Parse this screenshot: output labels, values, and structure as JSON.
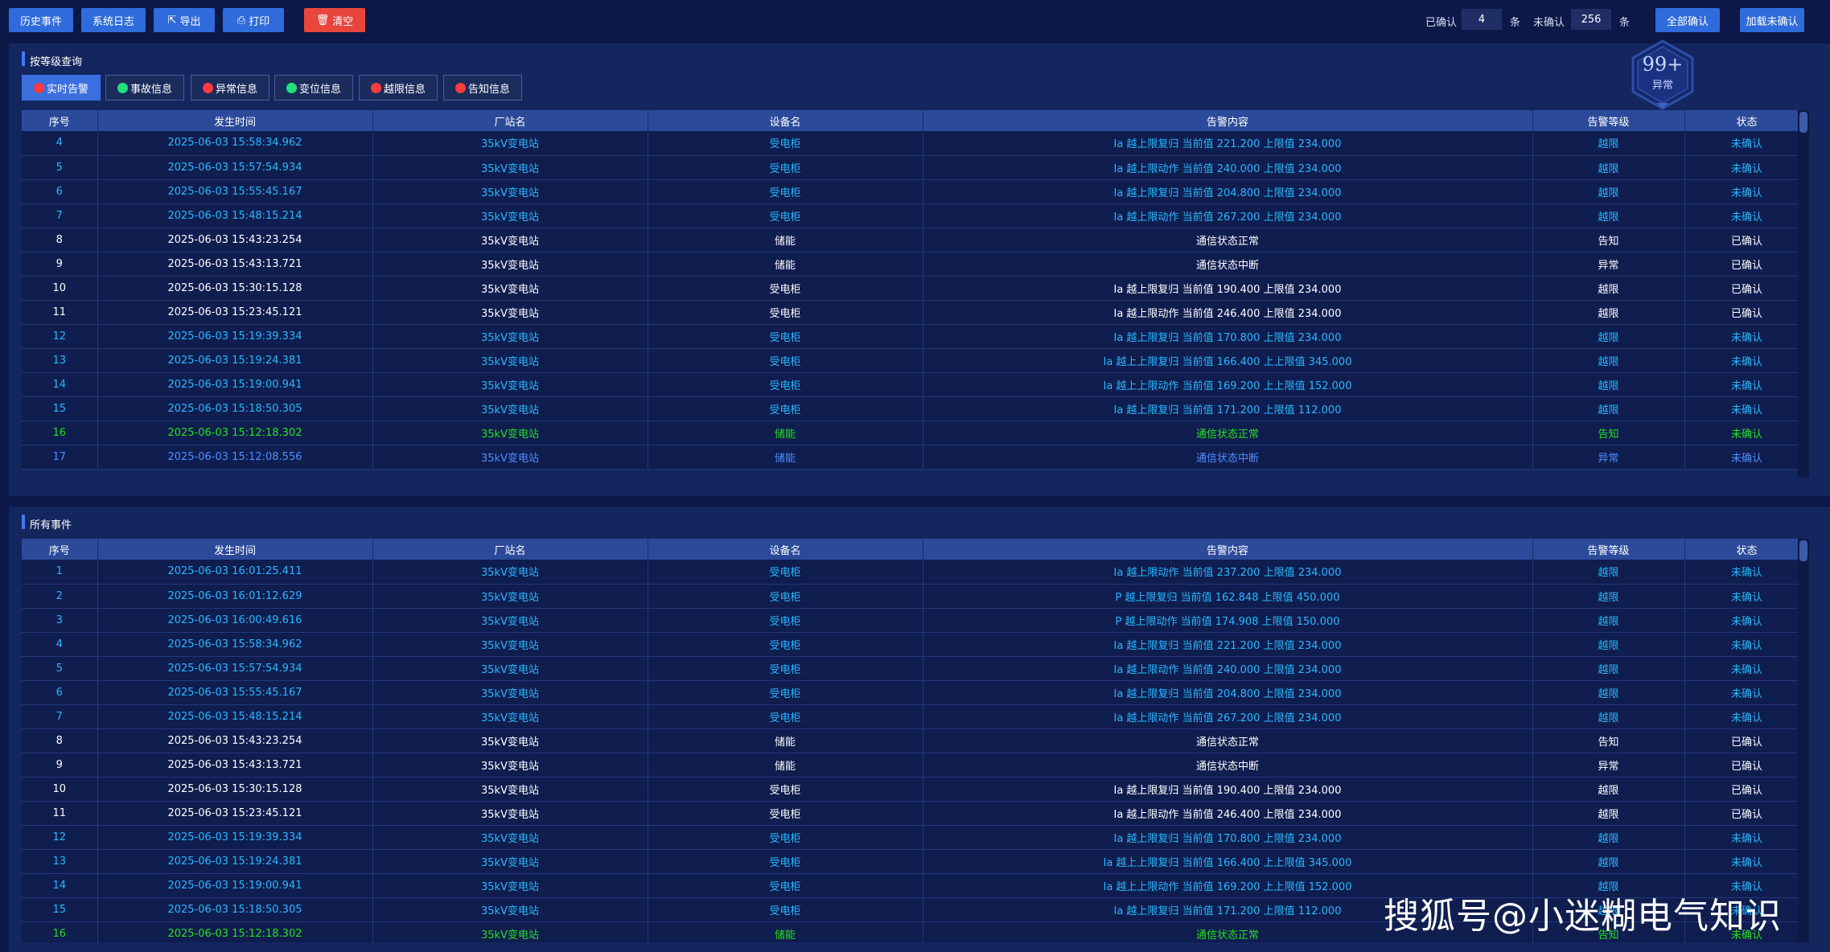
{
  "toolbar": {
    "history_label": "历史事件",
    "syslog_label": "系统日志",
    "export_label": "导出",
    "print_label": "打印",
    "clear_label": "清空",
    "confirmed_label": "已确认",
    "confirmed_count": "4",
    "unit1": "条",
    "unconfirmed_label": "未确认",
    "unconfirmed_count": "256",
    "unit2": "条",
    "confirm_all_label": "全部确认",
    "load_unconfirmed_label": "加载未确认"
  },
  "badge": {
    "count": "99+",
    "label": "异常"
  },
  "panel1": {
    "title": "按等级查询",
    "tabs": [
      {
        "label": "实时告警",
        "dot": "red"
      },
      {
        "label": "事故信息",
        "dot": "green"
      },
      {
        "label": "异常信息",
        "dot": "red"
      },
      {
        "label": "变位信息",
        "dot": "green"
      },
      {
        "label": "越限信息",
        "dot": "red"
      },
      {
        "label": "告知信息",
        "dot": "red"
      }
    ]
  },
  "panel2": {
    "title": "所有事件"
  },
  "columns": [
    "序号",
    "发生时间",
    "厂站名",
    "设备名",
    "告警内容",
    "告警等级",
    "状态"
  ],
  "table1_rows": [
    {
      "c": "cyan",
      "v": [
        "4",
        "2025-06-03 15:58:34.962",
        "35kV变电站",
        "受电柜",
        "Ia 越上限复归 当前值 221.200 上限值 234.000",
        "越限",
        "未确认"
      ]
    },
    {
      "c": "cyan",
      "v": [
        "5",
        "2025-06-03 15:57:54.934",
        "35kV变电站",
        "受电柜",
        "Ia 越上限动作 当前值 240.000 上限值 234.000",
        "越限",
        "未确认"
      ]
    },
    {
      "c": "cyan",
      "v": [
        "6",
        "2025-06-03 15:55:45.167",
        "35kV变电站",
        "受电柜",
        "Ia 越上限复归 当前值 204.800 上限值 234.000",
        "越限",
        "未确认"
      ]
    },
    {
      "c": "cyan",
      "v": [
        "7",
        "2025-06-03 15:48:15.214",
        "35kV变电站",
        "受电柜",
        "Ia 越上限动作 当前值 267.200 上限值 234.000",
        "越限",
        "未确认"
      ]
    },
    {
      "c": "white",
      "v": [
        "8",
        "2025-06-03 15:43:23.254",
        "35kV变电站",
        "储能",
        "通信状态正常",
        "告知",
        "已确认"
      ]
    },
    {
      "c": "white",
      "v": [
        "9",
        "2025-06-03 15:43:13.721",
        "35kV变电站",
        "储能",
        "通信状态中断",
        "异常",
        "已确认"
      ]
    },
    {
      "c": "white",
      "v": [
        "10",
        "2025-06-03 15:30:15.128",
        "35kV变电站",
        "受电柜",
        "Ia 越上限复归 当前值 190.400 上限值 234.000",
        "越限",
        "已确认"
      ]
    },
    {
      "c": "white",
      "v": [
        "11",
        "2025-06-03 15:23:45.121",
        "35kV变电站",
        "受电柜",
        "Ia 越上限动作 当前值 246.400 上限值 234.000",
        "越限",
        "已确认"
      ]
    },
    {
      "c": "cyan",
      "v": [
        "12",
        "2025-06-03 15:19:39.334",
        "35kV变电站",
        "受电柜",
        "Ia 越上限复归 当前值 170.800 上限值 234.000",
        "越限",
        "未确认"
      ]
    },
    {
      "c": "cyan",
      "v": [
        "13",
        "2025-06-03 15:19:24.381",
        "35kV变电站",
        "受电柜",
        "Ia 越上上限复归 当前值 166.400 上上限值 345.000",
        "越限",
        "未确认"
      ]
    },
    {
      "c": "cyan",
      "v": [
        "14",
        "2025-06-03 15:19:00.941",
        "35kV变电站",
        "受电柜",
        "Ia 越上上限动作 当前值 169.200 上上限值 152.000",
        "越限",
        "未确认"
      ]
    },
    {
      "c": "cyan",
      "v": [
        "15",
        "2025-06-03 15:18:50.305",
        "35kV变电站",
        "受电柜",
        "Ia 越上限复归 当前值 171.200 上限值 112.000",
        "越限",
        "未确认"
      ]
    },
    {
      "c": "green",
      "v": [
        "16",
        "2025-06-03 15:12:18.302",
        "35kV变电站",
        "储能",
        "通信状态正常",
        "告知",
        "未确认"
      ]
    },
    {
      "c": "blue",
      "v": [
        "17",
        "2025-06-03 15:12:08.556",
        "35kV变电站",
        "储能",
        "通信状态中断",
        "异常",
        "未确认"
      ]
    }
  ],
  "table2_rows": [
    {
      "c": "cyan",
      "v": [
        "1",
        "2025-06-03 16:01:25.411",
        "35kV变电站",
        "受电柜",
        "Ia 越上限动作 当前值 237.200 上限值 234.000",
        "越限",
        "未确认"
      ]
    },
    {
      "c": "cyan",
      "v": [
        "2",
        "2025-06-03 16:01:12.629",
        "35kV变电站",
        "受电柜",
        "P 越上限复归 当前值 162.848 上限值 450.000",
        "越限",
        "未确认"
      ]
    },
    {
      "c": "cyan",
      "v": [
        "3",
        "2025-06-03 16:00:49.616",
        "35kV变电站",
        "受电柜",
        "P 越上限动作 当前值 174.908 上限值 150.000",
        "越限",
        "未确认"
      ]
    },
    {
      "c": "cyan",
      "v": [
        "4",
        "2025-06-03 15:58:34.962",
        "35kV变电站",
        "受电柜",
        "Ia 越上限复归 当前值 221.200 上限值 234.000",
        "越限",
        "未确认"
      ]
    },
    {
      "c": "cyan",
      "v": [
        "5",
        "2025-06-03 15:57:54.934",
        "35kV变电站",
        "受电柜",
        "Ia 越上限动作 当前值 240.000 上限值 234.000",
        "越限",
        "未确认"
      ]
    },
    {
      "c": "cyan",
      "v": [
        "6",
        "2025-06-03 15:55:45.167",
        "35kV变电站",
        "受电柜",
        "Ia 越上限复归 当前值 204.800 上限值 234.000",
        "越限",
        "未确认"
      ]
    },
    {
      "c": "cyan",
      "v": [
        "7",
        "2025-06-03 15:48:15.214",
        "35kV变电站",
        "受电柜",
        "Ia 越上限动作 当前值 267.200 上限值 234.000",
        "越限",
        "未确认"
      ]
    },
    {
      "c": "white",
      "v": [
        "8",
        "2025-06-03 15:43:23.254",
        "35kV变电站",
        "储能",
        "通信状态正常",
        "告知",
        "已确认"
      ]
    },
    {
      "c": "white",
      "v": [
        "9",
        "2025-06-03 15:43:13.721",
        "35kV变电站",
        "储能",
        "通信状态中断",
        "异常",
        "已确认"
      ]
    },
    {
      "c": "white",
      "v": [
        "10",
        "2025-06-03 15:30:15.128",
        "35kV变电站",
        "受电柜",
        "Ia 越上限复归 当前值 190.400 上限值 234.000",
        "越限",
        "已确认"
      ]
    },
    {
      "c": "white",
      "v": [
        "11",
        "2025-06-03 15:23:45.121",
        "35kV变电站",
        "受电柜",
        "Ia 越上限动作 当前值 246.400 上限值 234.000",
        "越限",
        "已确认"
      ]
    },
    {
      "c": "cyan",
      "v": [
        "12",
        "2025-06-03 15:19:39.334",
        "35kV变电站",
        "受电柜",
        "Ia 越上限复归 当前值 170.800 上限值 234.000",
        "越限",
        "未确认"
      ]
    },
    {
      "c": "cyan",
      "v": [
        "13",
        "2025-06-03 15:19:24.381",
        "35kV变电站",
        "受电柜",
        "Ia 越上上限复归 当前值 166.400 上上限值 345.000",
        "越限",
        "未确认"
      ]
    },
    {
      "c": "cyan",
      "v": [
        "14",
        "2025-06-03 15:19:00.941",
        "35kV变电站",
        "受电柜",
        "Ia 越上上限动作 当前值 169.200 上上限值 152.000",
        "越限",
        "未确认"
      ]
    },
    {
      "c": "cyan",
      "v": [
        "15",
        "2025-06-03 15:18:50.305",
        "35kV变电站",
        "受电柜",
        "Ia 越上限复归 当前值 171.200 上限值 112.000",
        "越限",
        "未确认"
      ]
    },
    {
      "c": "green",
      "v": [
        "16",
        "2025-06-03 15:12:18.302",
        "35kV变电站",
        "储能",
        "通信状态正常",
        "告知",
        "未确认"
      ]
    }
  ],
  "watermark": "搜狐号@小迷糊电气知识"
}
